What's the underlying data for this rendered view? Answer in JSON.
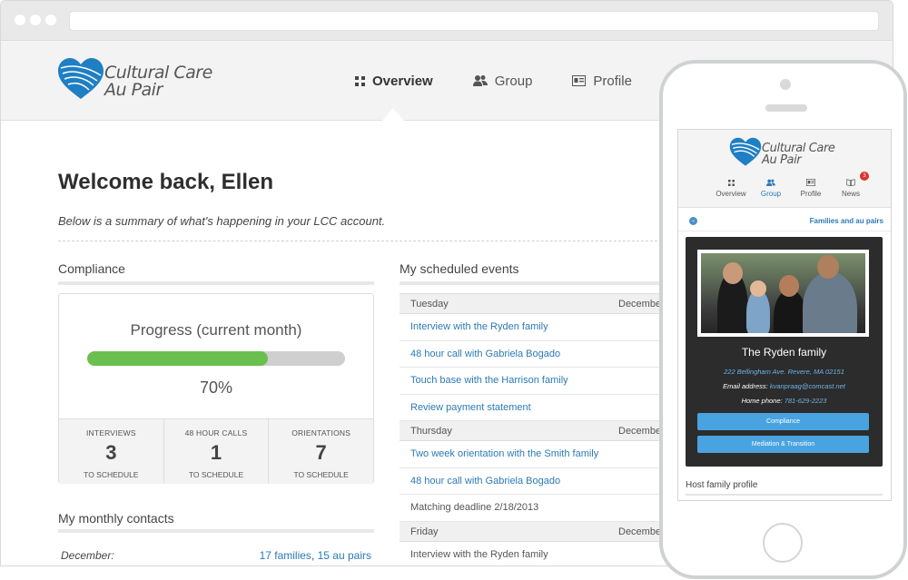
{
  "brand": {
    "line1": "Cultural Care",
    "line2": "Au Pair",
    "color": "#2b7ab5"
  },
  "nav": [
    {
      "label": "Overview",
      "icon": "grid-icon",
      "glyph": "▪▪"
    },
    {
      "label": "Group",
      "icon": "users-icon",
      "glyph": "👥"
    },
    {
      "label": "Profile",
      "icon": "id-card-icon",
      "glyph": "▤"
    }
  ],
  "welcome": "Welcome back, Ellen",
  "summary": "Below is a summary of what's happening in your LCC account.",
  "compliance": {
    "title": "Compliance",
    "progress_label": "Progress (current month)",
    "progress_value": 0.7,
    "progress_text": "70%",
    "stats": [
      {
        "label": "INTERVIEWS",
        "value": "3",
        "sub": "TO SCHEDULE"
      },
      {
        "label": "48 HOUR CALLS",
        "value": "1",
        "sub": "TO SCHEDULE"
      },
      {
        "label": "ORIENTATIONS",
        "value": "7",
        "sub": "TO SCHEDULE"
      }
    ]
  },
  "contacts": {
    "title": "My monthly contacts",
    "month": "December:",
    "families": "17 families",
    "separator": ",",
    "au_pairs": "15 au pairs"
  },
  "events": {
    "title": "My scheduled events",
    "groups": [
      {
        "day": "Tuesday",
        "month": "December",
        "items": [
          {
            "text": "Interview with the Ryden family",
            "link": true
          },
          {
            "text": "48 hour call with Gabriela Bogado",
            "link": true
          },
          {
            "text": "Touch base with the Harrison family",
            "link": true
          },
          {
            "text": "Review payment statement",
            "link": true
          }
        ]
      },
      {
        "day": "Thursday",
        "month": "December",
        "items": [
          {
            "text": "Two week orientation with the Smith family",
            "link": true
          },
          {
            "text": "48 hour call with Gabriela Bogado",
            "link": true
          },
          {
            "text": "Matching deadline 2/18/2013",
            "link": false
          }
        ]
      },
      {
        "day": "Friday",
        "month": "December",
        "items": [
          {
            "text": "Interview with the Ryden family",
            "link": false
          }
        ]
      }
    ]
  },
  "mobile": {
    "nav": [
      {
        "label": "Overview",
        "glyph": "▪▪"
      },
      {
        "label": "Group",
        "glyph": "👥"
      },
      {
        "label": "Profile",
        "glyph": "▤"
      },
      {
        "label": "News",
        "glyph": "📖",
        "badge": "3"
      }
    ],
    "sub_link": "Families and au pairs",
    "family_name": "The Ryden family",
    "address": "222 Bellingham Ave. Revere, MA 02151",
    "email_label": "Email address:",
    "email": "kvanpraag@comcast.net",
    "phone_label": "Home phone:",
    "phone": "781-629-2223",
    "btn1": "Compliance",
    "btn2": "Mediation & Transition",
    "host_profile": "Host family profile"
  }
}
